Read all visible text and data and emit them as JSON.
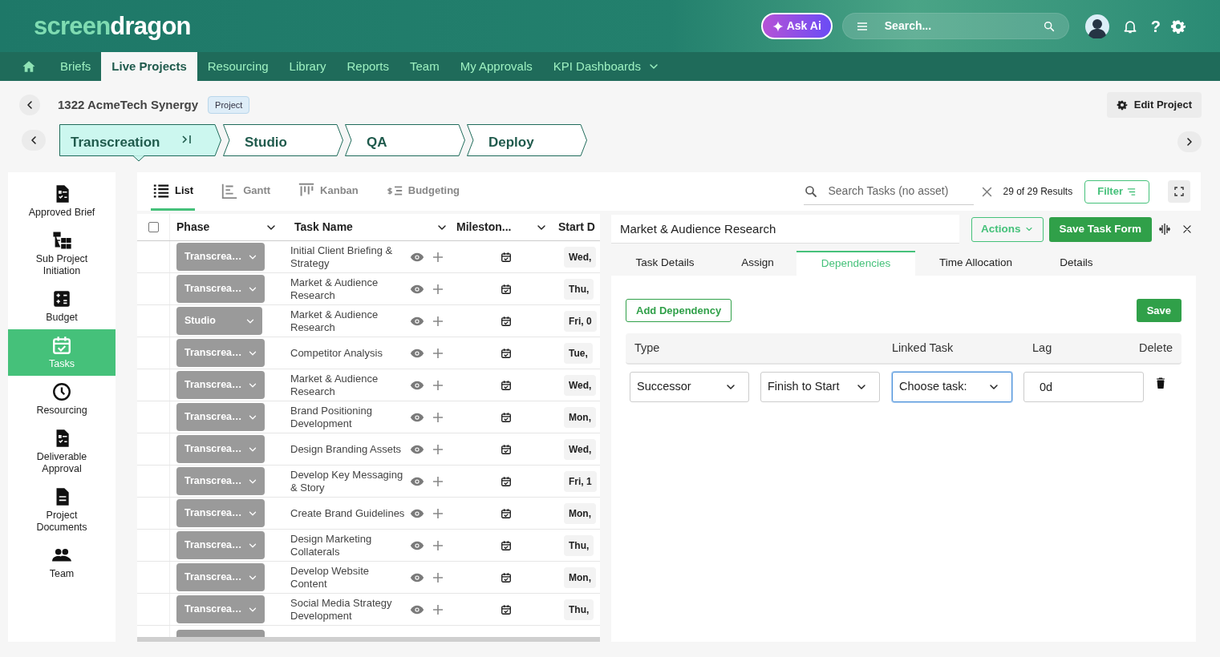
{
  "header": {
    "logo": {
      "part_1": "screen",
      "part_2": "dragon"
    },
    "ask_ai": "Ask Ai",
    "search": {
      "placeholder": "Search..."
    },
    "help": "?"
  },
  "nav": [
    {
      "label": "Briefs",
      "selected": false
    },
    {
      "label": "Live Projects",
      "selected": true
    },
    {
      "label": "Resourcing",
      "selected": false
    },
    {
      "label": "Library",
      "selected": false
    },
    {
      "label": "Reports",
      "selected": false
    },
    {
      "label": "Team",
      "selected": false
    },
    {
      "label": "My Approvals",
      "selected": false
    },
    {
      "label": "KPI Dashboards",
      "selected": false
    }
  ],
  "project": {
    "title": "1322 AcmeTech Synergy",
    "badge": "Project",
    "edit_button": "Edit Project"
  },
  "stages": [
    {
      "label": "Transcreation",
      "selected": true
    },
    {
      "label": "Studio",
      "selected": false
    },
    {
      "label": "QA",
      "selected": false
    },
    {
      "label": "Deploy",
      "selected": false
    }
  ],
  "sidebar": {
    "items": [
      {
        "label": "Approved Brief",
        "selected": false
      },
      {
        "label": "Sub Project Initiation",
        "selected": false
      },
      {
        "label": "Budget",
        "selected": false
      },
      {
        "label": "Tasks",
        "selected": true
      },
      {
        "label": "Resourcing",
        "selected": false
      },
      {
        "label": "Deliverable Approval",
        "selected": false
      },
      {
        "label": "Project Documents",
        "selected": false
      },
      {
        "label": "Team",
        "selected": false
      }
    ]
  },
  "views": [
    {
      "label": "List",
      "selected": true
    },
    {
      "label": "Gantt",
      "selected": false
    },
    {
      "label": "Kanban",
      "selected": false
    },
    {
      "label": "Budgeting",
      "selected": false
    }
  ],
  "toolbar": {
    "search_placeholder": "Search Tasks (no asset)",
    "results": "29 of 29 Results",
    "filter": "Filter"
  },
  "table": {
    "select_all": {
      "checked": false
    },
    "columns": [
      "Phase",
      "Task Name",
      "Mileston...",
      "Start D"
    ],
    "rows": [
      {
        "phase": "Transcrea…",
        "task": "Initial Client Briefing & Strategy",
        "start": "Wed,"
      },
      {
        "phase": "Transcrea…",
        "task": "Market & Audience Research",
        "start": "Thu,"
      },
      {
        "phase": "Studio",
        "task": "Market & Audience Research",
        "start": "Fri, 0"
      },
      {
        "phase": "Transcrea…",
        "task": "Competitor Analysis",
        "start": "Tue,"
      },
      {
        "phase": "Transcrea…",
        "task": "Market & Audience Research",
        "start": "Wed,"
      },
      {
        "phase": "Transcrea…",
        "task": "Brand Positioning Development",
        "start": "Mon,"
      },
      {
        "phase": "Transcrea…",
        "task": "Design Branding Assets",
        "start": "Wed,"
      },
      {
        "phase": "Transcrea…",
        "task": "Develop Key Messaging & Story",
        "start": "Fri, 1"
      },
      {
        "phase": "Transcrea…",
        "task": "Create Brand Guidelines",
        "start": "Mon,"
      },
      {
        "phase": "Transcrea…",
        "task": "Design Marketing Collaterals",
        "start": "Thu,"
      },
      {
        "phase": "Transcrea…",
        "task": "Develop Website Content",
        "start": "Mon,"
      },
      {
        "phase": "Transcrea…",
        "task": "Social Media Strategy Development",
        "start": "Thu,"
      }
    ]
  },
  "task_form": {
    "title": "Market & Audience Research",
    "actions": "Actions",
    "save_form": "Save Task Form",
    "tabs": [
      {
        "label": "Task Details",
        "selected": false
      },
      {
        "label": "Assign",
        "selected": false
      },
      {
        "label": "Dependencies",
        "selected": true
      },
      {
        "label": "Time Allocation",
        "selected": false
      },
      {
        "label": "Details",
        "selected": false
      }
    ],
    "add_dependency": "Add Dependency",
    "save": "Save",
    "columns": [
      "Type",
      "Linked Task",
      "Lag",
      "Delete"
    ],
    "dependencies": [
      {
        "type": "Successor",
        "relation": "Finish to Start",
        "linked_task": "Choose task:",
        "linked_focused": true,
        "lag": "0d"
      }
    ]
  }
}
